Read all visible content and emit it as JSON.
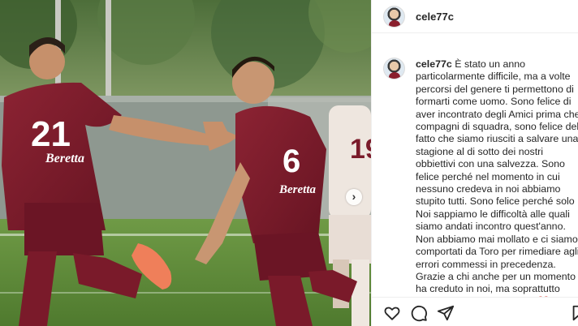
{
  "post": {
    "username": "cele77c",
    "caption": "È stato un anno particolarmente difficile, ma a volte percorsi del genere ti permettono di formarti come uomo. Sono felice di aver incontrato degli Amici prima che compagni di squadra, sono felice del fatto che siamo riusciti a salvare una stagione al di sotto dei nostri obbiettivi con una salvezza. Sono felice perché nel momento in cui nessuno credeva in noi abbiamo stupito tutti. Sono felice perché solo Noi sappiamo le difficoltà alle quali siamo andati incontro quest'anno. Non abbiamo mai mollato e ci siamo comportati da Toro per rimediare agli errori commessi in precedenza. Grazie a chi anche per un momento ha creduto in noi, ma soprattutto Grazie a Noi vi voglio Bene❤️"
  },
  "photo": {
    "left_player_number": "21",
    "left_player_sponsor": "Beretta",
    "right_player_number": "6",
    "right_player_sponsor": "Beretta",
    "bg_player_number": "19",
    "carousel_arrow": "›"
  },
  "icons": [
    "heart-icon",
    "comment-icon",
    "share-icon",
    "bookmark-icon"
  ],
  "colors": {
    "jersey": "#7a1a2a",
    "grass": "#5f8a3a",
    "text": "#262626"
  }
}
